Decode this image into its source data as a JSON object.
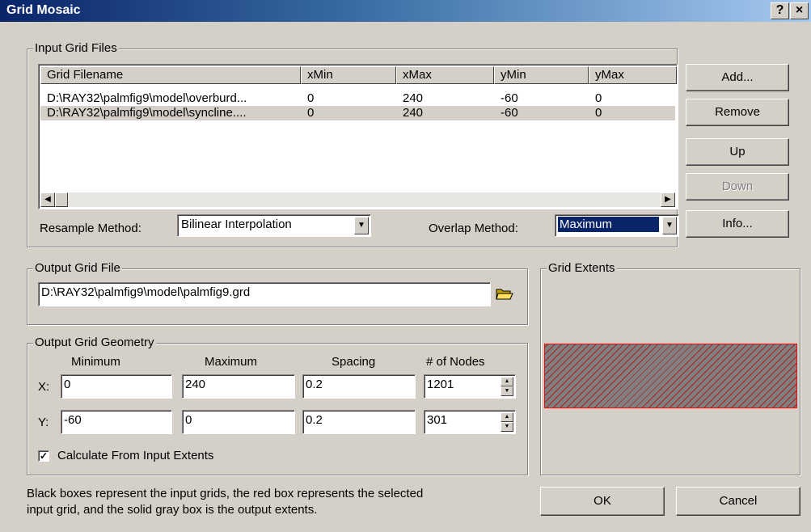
{
  "window": {
    "title": "Grid Mosaic",
    "help_label": "?",
    "close_label": "×"
  },
  "input_group": {
    "label": "Input Grid Files",
    "columns": [
      "Grid Filename",
      "xMin",
      "xMax",
      "yMin",
      "yMax"
    ],
    "rows": [
      [
        "D:\\RAY32\\palmfig9\\model\\overburd...",
        "0",
        "240",
        "-60",
        "0"
      ],
      [
        "D:\\RAY32\\palmfig9\\model\\syncline....",
        "0",
        "240",
        "-60",
        "0"
      ]
    ],
    "resample_label": "Resample Method:",
    "resample_value": "Bilinear Interpolation",
    "overlap_label": "Overlap Method:",
    "overlap_value": "Maximum"
  },
  "buttons": {
    "add": "Add...",
    "remove": "Remove",
    "up": "Up",
    "down": "Down",
    "info": "Info...",
    "ok": "OK",
    "cancel": "Cancel"
  },
  "output_file": {
    "label": "Output Grid File",
    "value": "D:\\RAY32\\palmfig9\\model\\palmfig9.grd"
  },
  "geometry": {
    "label": "Output Grid Geometry",
    "headers": [
      "Minimum",
      "Maximum",
      "Spacing",
      "# of Nodes"
    ],
    "x_label": "X:",
    "y_label": "Y:",
    "x": {
      "min": "0",
      "max": "240",
      "spacing": "0.2",
      "nodes": "1201"
    },
    "y": {
      "min": "-60",
      "max": "0",
      "spacing": "0.2",
      "nodes": "301"
    },
    "calc_label": "Calculate From Input Extents",
    "calc_checked": true
  },
  "extents": {
    "label": "Grid Extents"
  },
  "footer_text_1": "Black boxes represent the input grids, the red box represents the selected",
  "footer_text_2": "input grid, and the solid gray box is the output extents.",
  "colors": {
    "title_start": "#0a246a",
    "title_end": "#a6caf0",
    "dialog": "#d4d0c8",
    "selection": "#0a246a",
    "extent_border": "#ff0000"
  }
}
